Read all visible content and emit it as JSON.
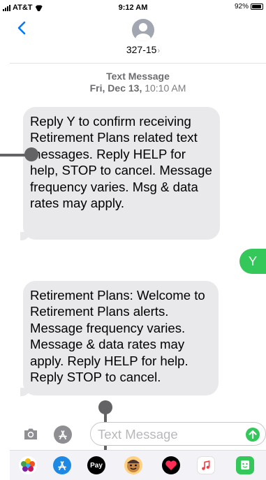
{
  "status_bar": {
    "carrier": "AT&T",
    "time": "9:12 AM",
    "battery": "92%",
    "battery_level": 0.92
  },
  "header": {
    "contact_name": "327-15",
    "chevron": "›"
  },
  "thread": {
    "service_label": "Text Message",
    "timestamp": "Fri, Dec 13, 10:10 AM",
    "timestamp_day": "Fri, Dec 13,",
    "timestamp_time": "10:10 AM",
    "messages": [
      {
        "direction": "incoming",
        "text": "Reply Y to confirm receiving Retirement Plans related text messages. Reply HELP for help, STOP to cancel. Message frequency varies. Msg & data rates may apply."
      },
      {
        "direction": "outgoing",
        "text": "Y"
      },
      {
        "direction": "incoming",
        "text": "Retirement Plans: Welcome to Retirement Plans alerts. Message frequency varies. Message & data rates may apply. Reply HELP for help. Reply STOP to cancel."
      }
    ]
  },
  "composer": {
    "placeholder": "Text Message",
    "camera_icon": "camera-icon",
    "apps_icon": "app-store-icon",
    "send_icon": "send-arrow-icon"
  },
  "app_drawer": {
    "items": [
      "photos-icon",
      "app-store-icon",
      "apple-pay-icon",
      "memoji-icon",
      "digital-touch-icon",
      "music-icon",
      "sticker-app-icon"
    ],
    "pay_label": "Pay"
  },
  "colors": {
    "accent": "#007aff",
    "incoming_bubble": "#e9e9eb",
    "outgoing_bubble": "#34c759",
    "annotation": "#636366"
  }
}
